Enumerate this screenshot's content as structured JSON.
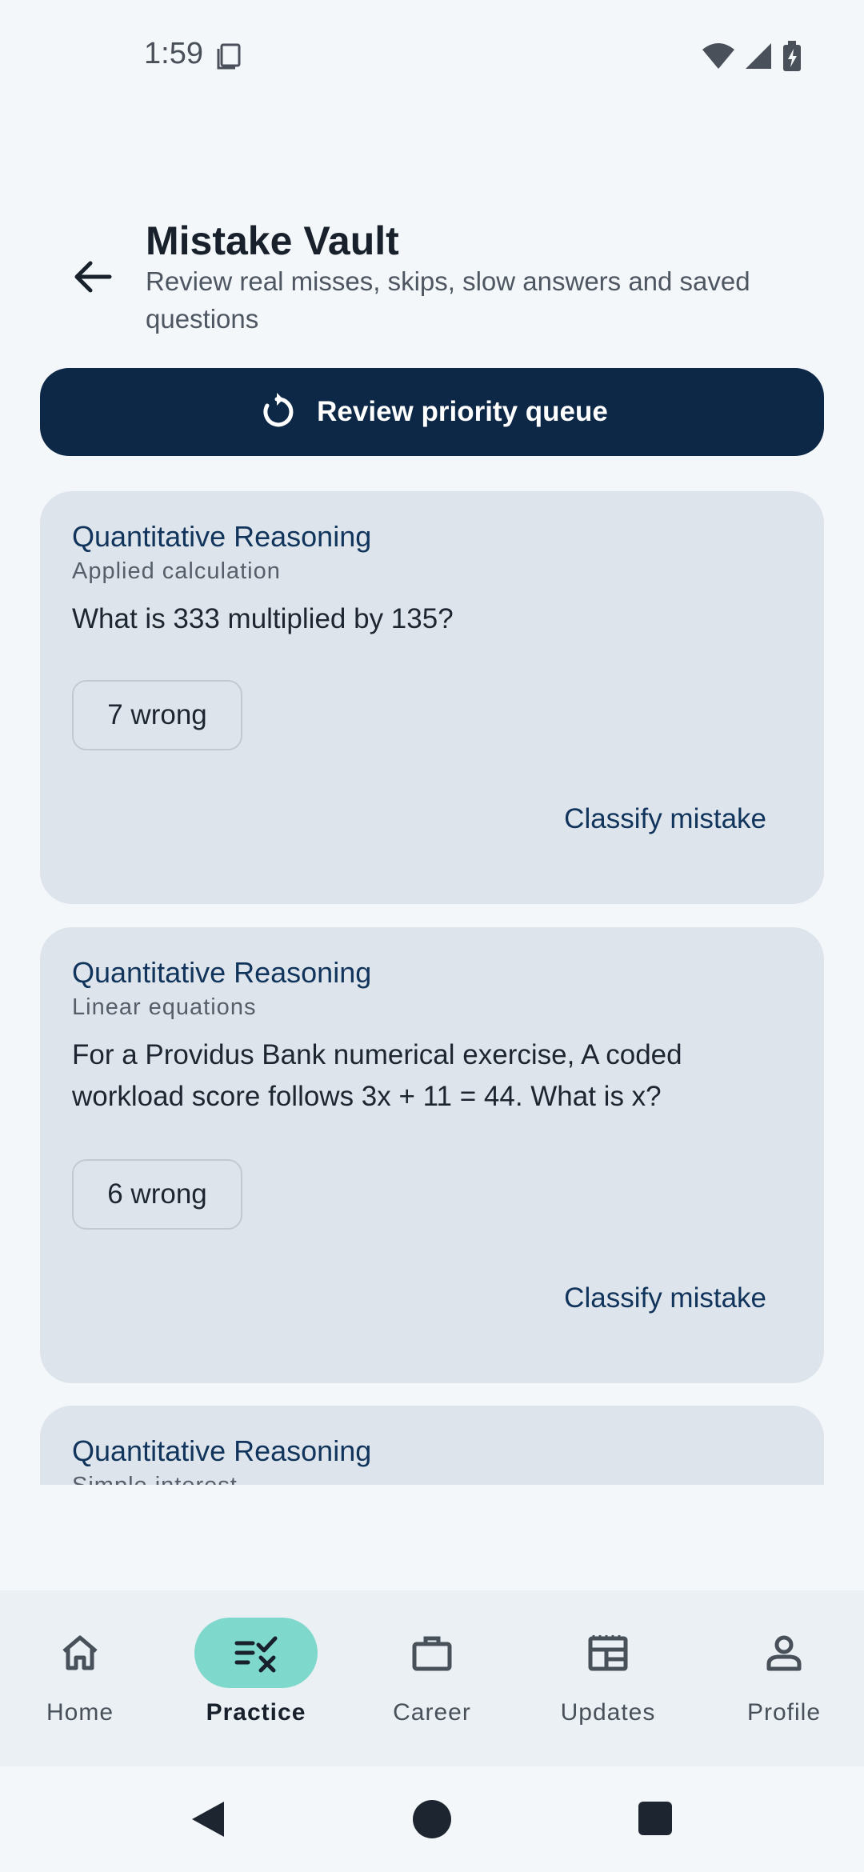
{
  "status_bar": {
    "time": "1:59"
  },
  "header": {
    "title": "Mistake Vault",
    "subtitle": "Review real misses, skips, slow answers and saved questions"
  },
  "primary_action": {
    "label": "Review priority queue"
  },
  "cards": [
    {
      "subject": "Quantitative Reasoning",
      "topic": "Applied calculation",
      "question": "What is 333 multiplied by 135?",
      "wrong": "7 wrong",
      "action": "Classify mistake"
    },
    {
      "subject": "Quantitative Reasoning",
      "topic": "Linear equations",
      "question": "For a Providus Bank numerical exercise, A coded workload score follows 3x + 11 = 44. What is x?",
      "wrong": "6 wrong",
      "action": "Classify mistake"
    },
    {
      "subject": "Quantitative Reasoning",
      "topic": "Simple interest"
    }
  ],
  "bottom_nav": [
    {
      "label": "Home",
      "icon": "home-icon"
    },
    {
      "label": "Practice",
      "icon": "practice-icon",
      "active": true
    },
    {
      "label": "Career",
      "icon": "briefcase-icon"
    },
    {
      "label": "Updates",
      "icon": "newspaper-icon"
    },
    {
      "label": "Profile",
      "icon": "person-icon"
    }
  ],
  "colors": {
    "primary": "#0d2847",
    "accent": "#7ed8cc",
    "card": "#dee4eb",
    "background": "#f3f7fa"
  }
}
